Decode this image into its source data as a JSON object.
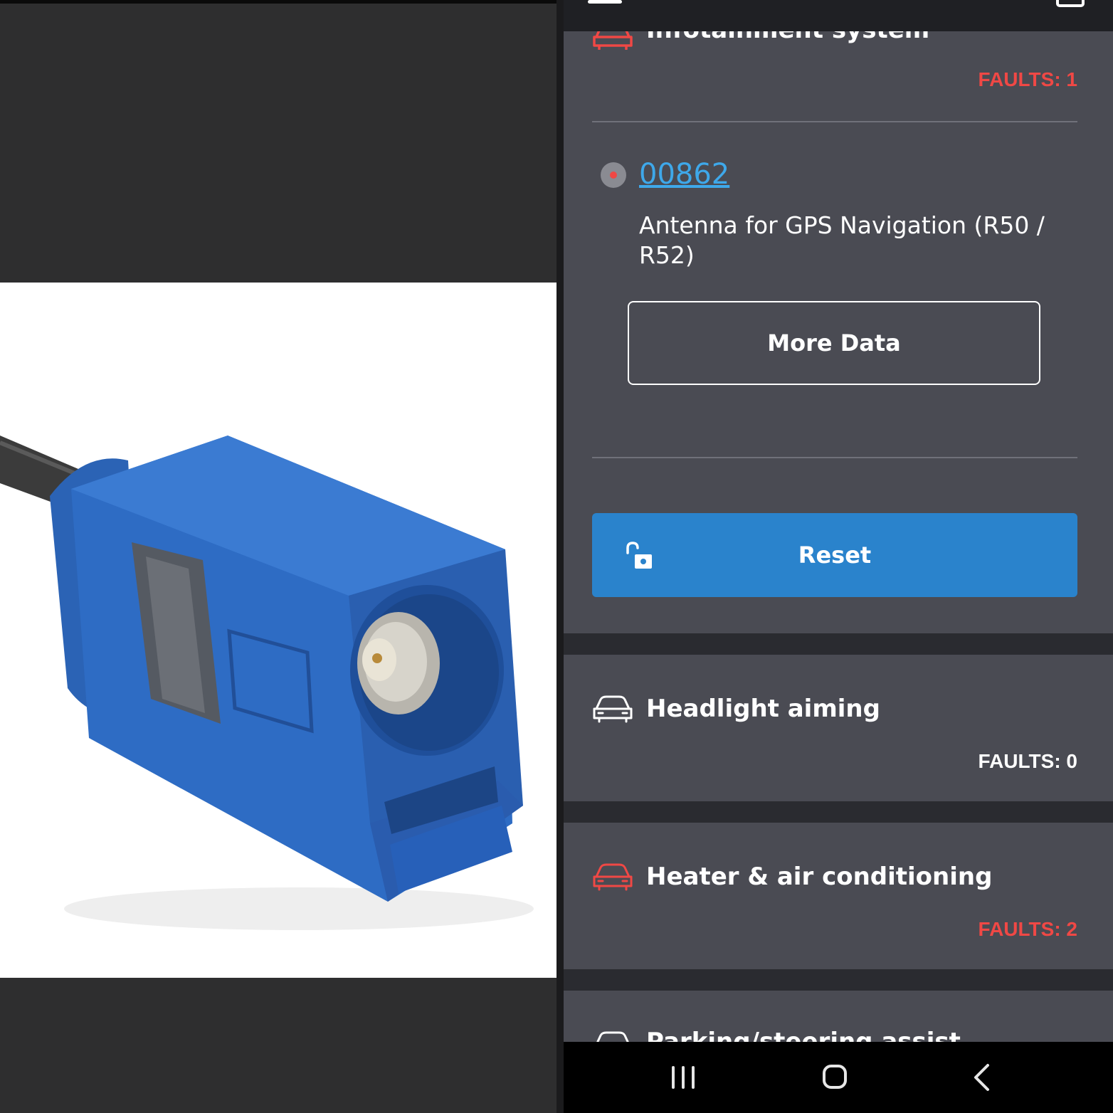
{
  "app": {
    "systems": [
      {
        "name": "Infotainment system",
        "faults_label": "FAULTS: 1",
        "icon": "car-icon",
        "status_color": "#f04845"
      },
      {
        "name": "Headlight aiming",
        "faults_label": "FAULTS: 0",
        "icon": "car-icon",
        "status_color": "#ffffff"
      },
      {
        "name": "Heater & air conditioning",
        "faults_label": "FAULTS: 2",
        "icon": "car-icon",
        "status_color": "#f04845"
      },
      {
        "name": "Parking/steering assist",
        "icon": "car-icon",
        "status_color": "#ffffff"
      }
    ],
    "fault": {
      "code": "00862",
      "description": "Antenna for GPS Navigation (R50 / R52)",
      "status_icon": "red-dot-icon"
    },
    "buttons": {
      "more_data": "More Data",
      "reset": "Reset"
    }
  },
  "colors": {
    "accent_blue": "#2a83cc",
    "fault_red": "#f04845",
    "link_blue": "#3ea8ea",
    "card_bg": "#4a4b53"
  },
  "nav": {
    "recents_icon": "recents-icon",
    "home_icon": "home-icon",
    "back_icon": "back-icon"
  }
}
